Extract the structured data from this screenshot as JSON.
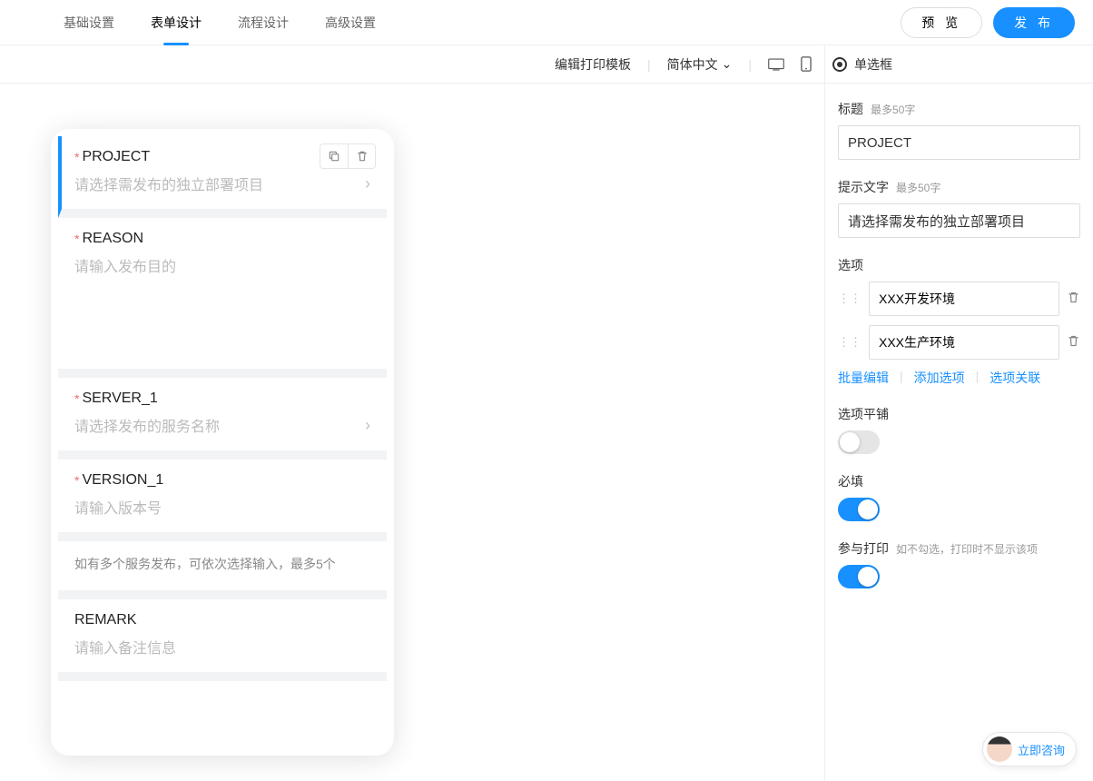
{
  "topTabs": [
    {
      "label": "基础设置",
      "active": false
    },
    {
      "label": "表单设计",
      "active": true
    },
    {
      "label": "流程设计",
      "active": false
    },
    {
      "label": "高级设置",
      "active": false
    }
  ],
  "actions": {
    "preview": "预 览",
    "publish": "发 布"
  },
  "toolbar": {
    "editPrintTemplate": "编辑打印模板",
    "lang": "简体中文"
  },
  "componentType": "单选框",
  "formItems": [
    {
      "title": "PROJECT",
      "placeholder": "请选择需发布的独立部署项目",
      "required": true,
      "type": "select",
      "selected": true
    },
    {
      "title": "REASON",
      "placeholder": "请输入发布目的",
      "required": true,
      "type": "textarea"
    },
    {
      "title": "SERVER_1",
      "placeholder": "请选择发布的服务名称",
      "required": true,
      "type": "select"
    },
    {
      "title": "VERSION_1",
      "placeholder": "请输入版本号",
      "required": true,
      "type": "input"
    },
    {
      "title": "",
      "placeholder": "如有多个服务发布，可依次选择输入，最多5个",
      "required": false,
      "type": "desc"
    },
    {
      "title": "REMARK",
      "placeholder": "请输入备注信息",
      "required": false,
      "type": "input"
    }
  ],
  "props": {
    "titleLabel": "标题",
    "titleHint": "最多50字",
    "titleValue": "PROJECT",
    "hintLabel": "提示文字",
    "hintHint": "最多50字",
    "hintValue": "请选择需发布的独立部署项目",
    "optionsLabel": "选项",
    "options": [
      "XXX开发环境",
      "XXX生产环境"
    ],
    "links": {
      "batch": "批量编辑",
      "add": "添加选项",
      "relate": "选项关联"
    },
    "tileLabel": "选项平铺",
    "tileOn": false,
    "requiredLabel": "必填",
    "requiredOn": true,
    "printLabel": "参与打印",
    "printHint": "如不勾选，打印时不显示该项",
    "printOn": true
  },
  "help": "立即咨询"
}
